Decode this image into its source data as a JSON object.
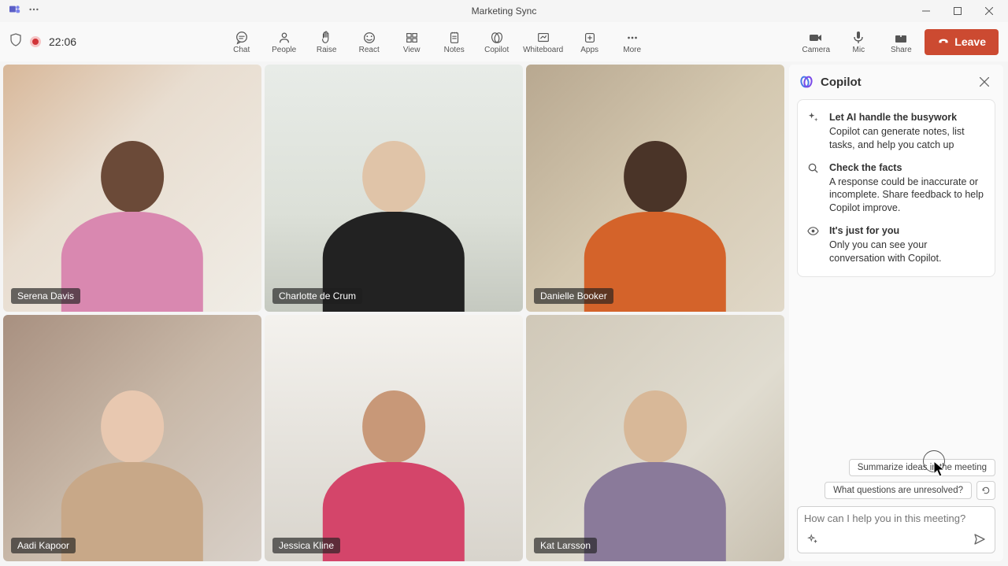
{
  "window": {
    "title": "Marketing Sync"
  },
  "timer": "22:06",
  "toolbar": [
    {
      "label": "Chat"
    },
    {
      "label": "People"
    },
    {
      "label": "Raise"
    },
    {
      "label": "React"
    },
    {
      "label": "View"
    },
    {
      "label": "Notes"
    },
    {
      "label": "Copilot"
    },
    {
      "label": "Whiteboard"
    },
    {
      "label": "Apps"
    },
    {
      "label": "More"
    }
  ],
  "media": [
    {
      "label": "Camera"
    },
    {
      "label": "Mic"
    },
    {
      "label": "Share"
    }
  ],
  "leave": "Leave",
  "participants": [
    {
      "name": "Serena Davis"
    },
    {
      "name": "Charlotte de Crum"
    },
    {
      "name": "Danielle Booker"
    },
    {
      "name": "Aadi Kapoor"
    },
    {
      "name": "Jessica Kline"
    },
    {
      "name": "Kat Larsson"
    }
  ],
  "copilot": {
    "title": "Copilot",
    "tips": [
      {
        "title": "Let AI handle the busywork",
        "body": "Copilot can generate notes, list tasks, and help you catch up"
      },
      {
        "title": "Check the facts",
        "body": "A response could be inaccurate or incomplete. Share feedback to help Copilot improve."
      },
      {
        "title": "It's just for you",
        "body": "Only you can see your conversation with Copilot."
      }
    ],
    "suggestions": [
      "Summarize ideas in the meeting",
      "What questions are unresolved?"
    ],
    "placeholder": "How can I help you in this meeting?"
  }
}
